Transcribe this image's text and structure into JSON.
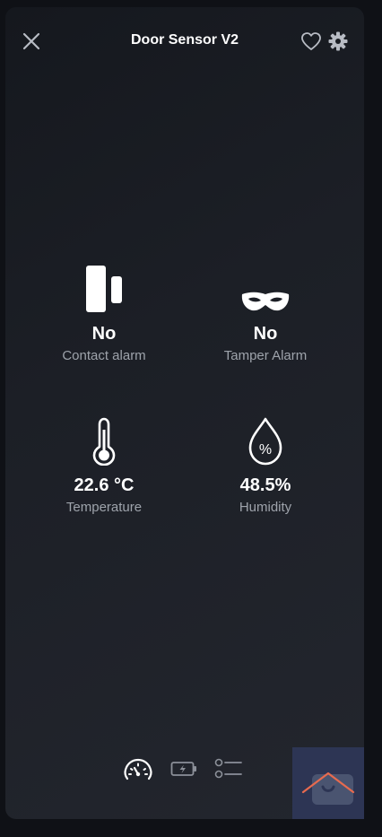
{
  "header": {
    "title": "Door Sensor V2"
  },
  "tiles": [
    {
      "icon": "door-contact-icon",
      "value": "No",
      "label": "Contact alarm"
    },
    {
      "icon": "mask-icon",
      "value": "No",
      "label": "Tamper Alarm"
    },
    {
      "icon": "thermometer-icon",
      "value": "22.6 °C",
      "label": "Temperature"
    },
    {
      "icon": "humidity-drop-icon",
      "value": "48.5%",
      "label": "Humidity"
    }
  ],
  "nav": {
    "items": [
      "speedometer-icon",
      "battery-icon",
      "list-icon"
    ],
    "active": "speedometer-icon"
  },
  "colors": {
    "text": "#ffffff",
    "label": "#9ea3ab",
    "icon_muted": "#8c9099"
  }
}
